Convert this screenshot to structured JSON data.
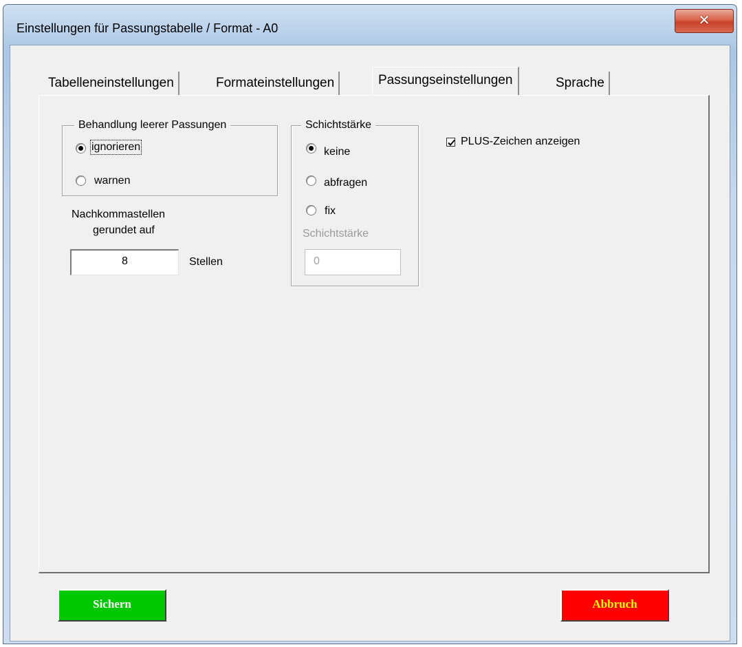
{
  "window": {
    "title": "Einstellungen für Passungstabelle / Format - A0",
    "close_icon": "close-icon"
  },
  "tabs": [
    {
      "label": "Tabelleneinstellungen",
      "active": false
    },
    {
      "label": "Formateinstellungen",
      "active": false
    },
    {
      "label": "Passungseinstellungen",
      "active": true
    },
    {
      "label": "Sprache",
      "active": false
    }
  ],
  "empty_fits": {
    "caption": "Behandlung leerer Passungen",
    "options": [
      {
        "label": "ignorieren",
        "checked": true
      },
      {
        "label": "warnen",
        "checked": false
      }
    ]
  },
  "decimals": {
    "label_line1": "Nachkommastellen",
    "label_line2": "gerundet auf",
    "value": "8",
    "unit": "Stellen"
  },
  "layer_thickness": {
    "caption": "Schichtstärke",
    "options": [
      {
        "label": "keine",
        "checked": true
      },
      {
        "label": "abfragen",
        "checked": false
      },
      {
        "label": "fix",
        "checked": false
      }
    ],
    "field_label": "Schichtstärke",
    "field_value": "0"
  },
  "plus_sign": {
    "label": "PLUS-Zeichen anzeigen",
    "checked": true
  },
  "buttons": {
    "save": {
      "label": "Sichern",
      "bg": "#00c800",
      "color": "#ffffff"
    },
    "cancel": {
      "label": "Abbruch",
      "bg": "#ff0000",
      "color": "#ffff00"
    }
  }
}
